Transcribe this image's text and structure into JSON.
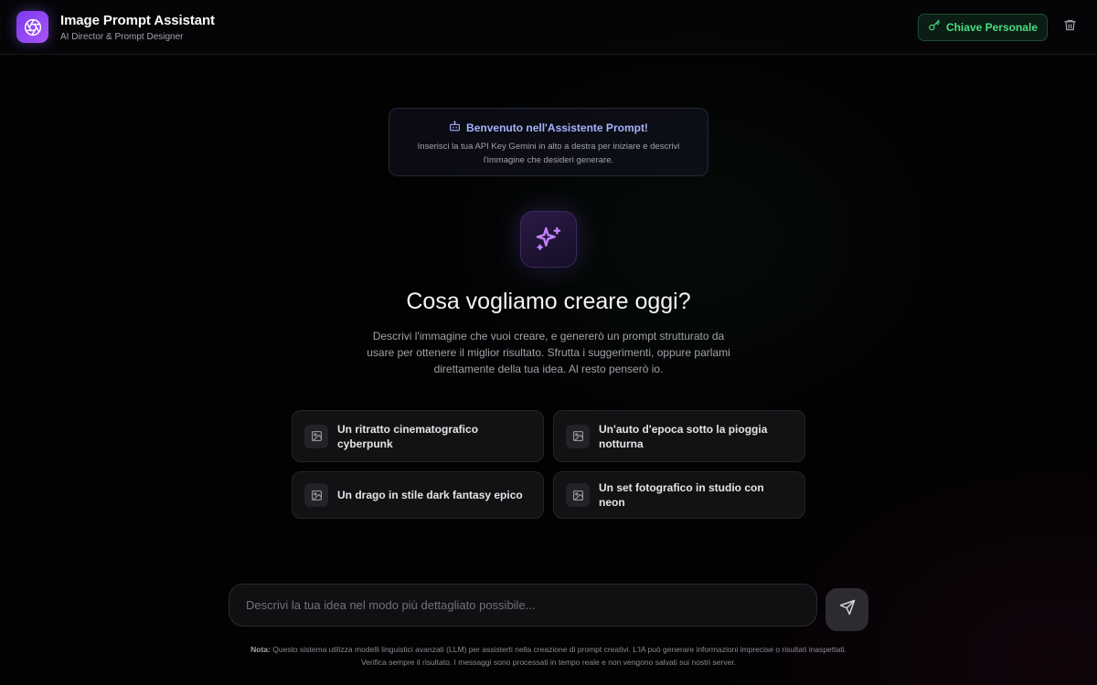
{
  "header": {
    "title": "Image Prompt Assistant",
    "subtitle": "AI Director & Prompt Designer",
    "key_button": "Chiave Personale"
  },
  "welcome": {
    "title": "Benvenuto nell'Assistente Prompt!",
    "text": "Inserisci la tua API Key Gemini in alto a destra per iniziare e descrivi l'immagine che desideri generare."
  },
  "hero": {
    "title": "Cosa vogliamo creare oggi?",
    "text": "Descrivi l'immagine che vuoi creare, e genererò un prompt strutturato da usare per ottenere il miglior risultato. Sfrutta i suggerimenti, oppure parlami direttamente della tua idea. Al resto penserò io."
  },
  "suggestions": [
    {
      "label": "Un ritratto cinematografico cyberpunk"
    },
    {
      "label": "Un'auto d'epoca sotto la pioggia notturna"
    },
    {
      "label": "Un drago in stile dark fantasy epico"
    },
    {
      "label": "Un set fotografico in studio con neon"
    }
  ],
  "input": {
    "placeholder": "Descrivi la tua idea nel modo più dettagliato possibile...",
    "value": ""
  },
  "note": {
    "label": "Nota:",
    "text": "Questo sistema utilizza modelli linguistici avanzati (LLM) per assisterti nella creazione di prompt creativi. L'IA può generare informazioni imprecise o risultati inaspettati. Verifica sempre il risultato. I messaggi sono processati in tempo reale e non vengono salvati sui nostri server."
  },
  "icons": {
    "logo": "aperture-icon",
    "key": "key-icon",
    "trash": "trash-icon",
    "welcome": "bot-icon",
    "hero": "sparkles-icon",
    "suggestion": "image-icon",
    "send": "send-icon"
  },
  "colors": {
    "accent": "#8b5cf6",
    "key_green": "#4ade80",
    "welcome_title": "#a5b4fc"
  }
}
